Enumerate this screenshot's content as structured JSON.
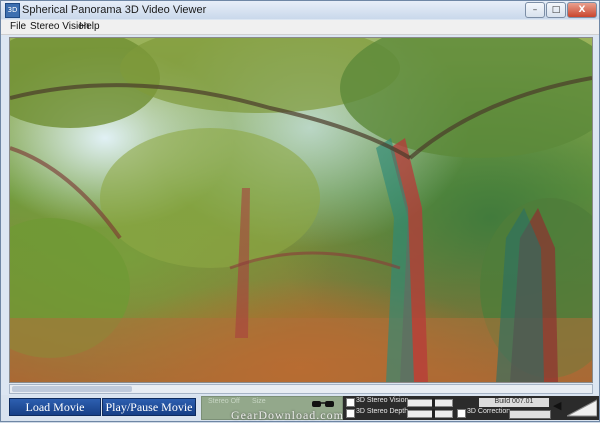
{
  "window": {
    "title": "Spherical Panorama 3D Video Viewer",
    "icon": "app-icon",
    "controls": {
      "minimize": "–",
      "maximize": "□",
      "close": "X"
    }
  },
  "menu": {
    "items": [
      "File",
      "Stereo Vision",
      "Help"
    ]
  },
  "viewer": {
    "content": "anaglyph forest scene"
  },
  "controls": {
    "load_label": "Load Movie",
    "play_label": "Play/Pause Movie",
    "stereo_off_label": "Stereo Off",
    "size_label": "Size",
    "stereo_vision_label": "3D Stereo Vision",
    "stereo_depth_label": "3D Stereo Depth",
    "correction_label": "3D Correction",
    "build_label": "Build 007.01",
    "stereo_vision_level": 0.55,
    "stereo_depth_level": 0.55
  },
  "watermark": "GearDownload.com",
  "colors": {
    "button_blue": "#1f4a98",
    "panel_dark": "#2b2b2b",
    "panel_green": "#93a88b"
  }
}
